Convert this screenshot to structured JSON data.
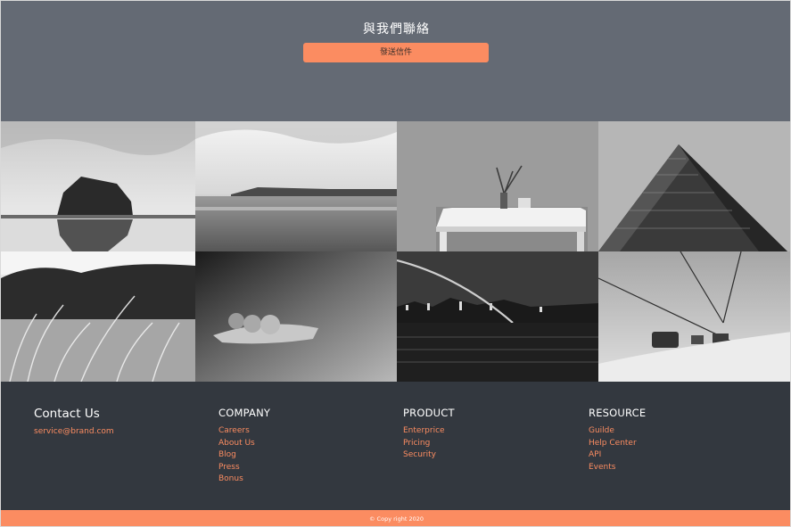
{
  "contact": {
    "title": "與我們聯絡",
    "button_label": "發送信件"
  },
  "gallery": {
    "images": [
      {
        "subject": "rock-island-beach"
      },
      {
        "subject": "calm-sea-shoreline"
      },
      {
        "subject": "table-with-vase"
      },
      {
        "subject": "skyscraper-corner"
      },
      {
        "subject": "wheat-grass-field"
      },
      {
        "subject": "pebbles-on-leaf"
      },
      {
        "subject": "bridge-city-night"
      },
      {
        "subject": "ski-lift-gondola"
      }
    ]
  },
  "footer": {
    "contact": {
      "title": "Contact Us",
      "email": "service@brand.com"
    },
    "company": {
      "title": "COMPANY",
      "links": [
        "Careers",
        "About Us",
        "Blog",
        "Press",
        "Bonus"
      ]
    },
    "product": {
      "title": "PRODUCT",
      "links": [
        "Enterprice",
        "Pricing",
        "Security"
      ]
    },
    "resource": {
      "title": "RESOURCE",
      "links": [
        "Guilde",
        "Help Center",
        "API",
        "Events"
      ]
    }
  },
  "copyright": "© Copy right 2020",
  "colors": {
    "hero_bg": "#646a74",
    "accent": "#fb8c61",
    "footer_bg": "#33383f"
  }
}
